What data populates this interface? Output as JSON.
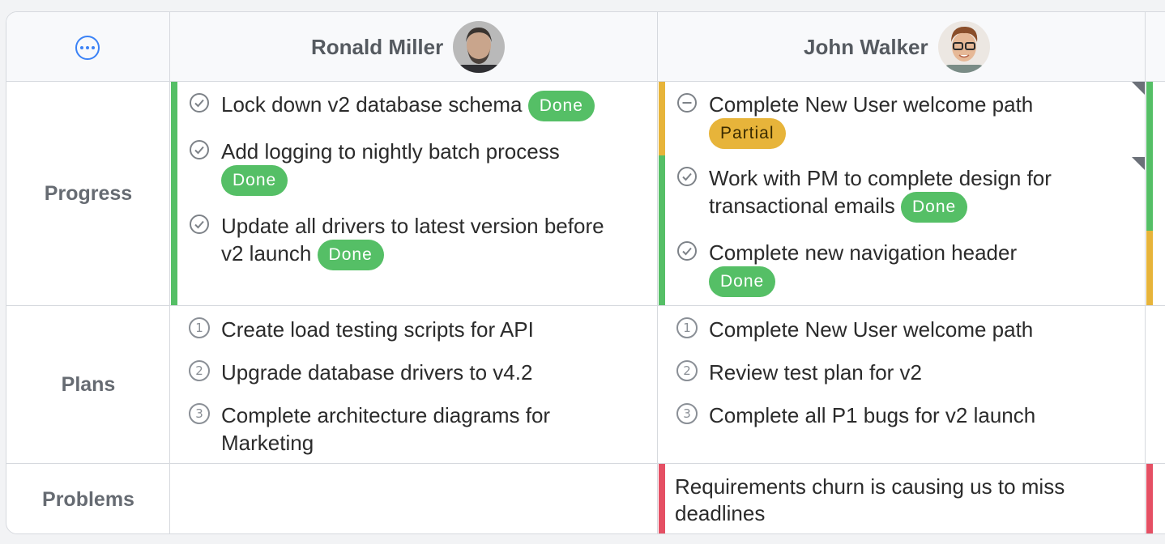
{
  "header": {
    "menu_icon": "more-horizontal-icon",
    "people": [
      {
        "name": "Ronald Miller"
      },
      {
        "name": "John Walker"
      }
    ]
  },
  "rows": {
    "progress": "Progress",
    "plans": "Plans",
    "problems": "Problems"
  },
  "ronald": {
    "progress": [
      {
        "text": "Lock down v2 database schema",
        "status": "Done"
      },
      {
        "text": "Add logging to nightly batch process",
        "status": "Done"
      },
      {
        "text": "Update all drivers to latest version before v2 launch",
        "status": "Done"
      }
    ],
    "plans": [
      {
        "num": "1",
        "text": "Create load testing scripts for API"
      },
      {
        "num": "2",
        "text": "Upgrade database drivers to v4.2"
      },
      {
        "num": "3",
        "text": "Complete architecture diagrams for Marketing"
      }
    ]
  },
  "john": {
    "progress": [
      {
        "text": "Complete New User welcome path",
        "status": "Partial"
      },
      {
        "text": "Work with PM to complete design for transactional emails",
        "status": "Done"
      },
      {
        "text": "Complete new navigation header",
        "status": "Done"
      }
    ],
    "plans": [
      {
        "num": "1",
        "text": "Complete New User welcome path"
      },
      {
        "num": "2",
        "text": "Review test plan for v2"
      },
      {
        "num": "3",
        "text": "Complete all P1 bugs for v2 launch"
      }
    ],
    "problems": [
      {
        "text": "Requirements churn is causing us to miss deadlines"
      }
    ]
  },
  "colors": {
    "done": "#55bf66",
    "partial": "#e7b43a",
    "problem": "#e55064",
    "accent": "#3b82f6"
  }
}
